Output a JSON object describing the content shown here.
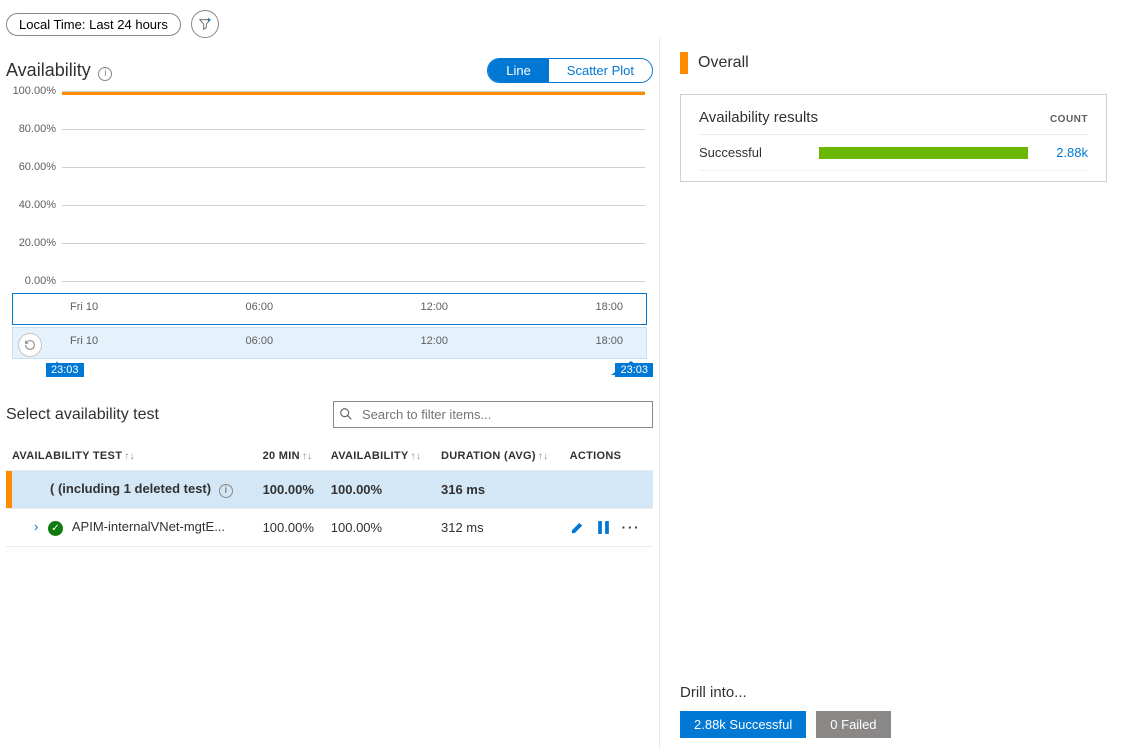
{
  "filters": {
    "time_label": "Local Time: Last 24 hours"
  },
  "availability": {
    "title": "Availability",
    "toggle": {
      "line": "Line",
      "scatter": "Scatter Plot"
    }
  },
  "chart_data": {
    "type": "line",
    "title": "Availability",
    "ylabel": "",
    "ylim": [
      0,
      100
    ],
    "y_ticks": [
      "100.00%",
      "80.00%",
      "60.00%",
      "40.00%",
      "20.00%",
      "0.00%"
    ],
    "x_ticks": [
      "Fri 10",
      "06:00",
      "12:00",
      "18:00"
    ],
    "brush": {
      "start": "23:03",
      "end": "23:03"
    },
    "series": [
      {
        "name": "Availability",
        "color": "#ff8c00",
        "value_constant_pct": 100.0
      }
    ]
  },
  "tests": {
    "section_title": "Select availability test",
    "search_placeholder": "Search to filter items...",
    "columns": {
      "c1": "AVAILABILITY TEST",
      "c2": "20 MIN",
      "c3": "AVAILABILITY",
      "c4": "DURATION (AVG)",
      "c5": "ACTIONS"
    },
    "summary": {
      "label": "(including 1 deleted test)",
      "twenty_min": "100.00%",
      "availability": "100.00%",
      "duration": "316 ms"
    },
    "rows": [
      {
        "name": "APIM-internalVNet-mgtE...",
        "twenty_min": "100.00%",
        "availability": "100.00%",
        "duration": "312 ms"
      }
    ]
  },
  "overall": {
    "title": "Overall",
    "card_title": "Availability results",
    "count_label": "COUNT",
    "rows": [
      {
        "label": "Successful",
        "count": "2.88k"
      }
    ]
  },
  "drill": {
    "title": "Drill into...",
    "success_btn": "2.88k Successful",
    "failed_btn": "0 Failed"
  }
}
